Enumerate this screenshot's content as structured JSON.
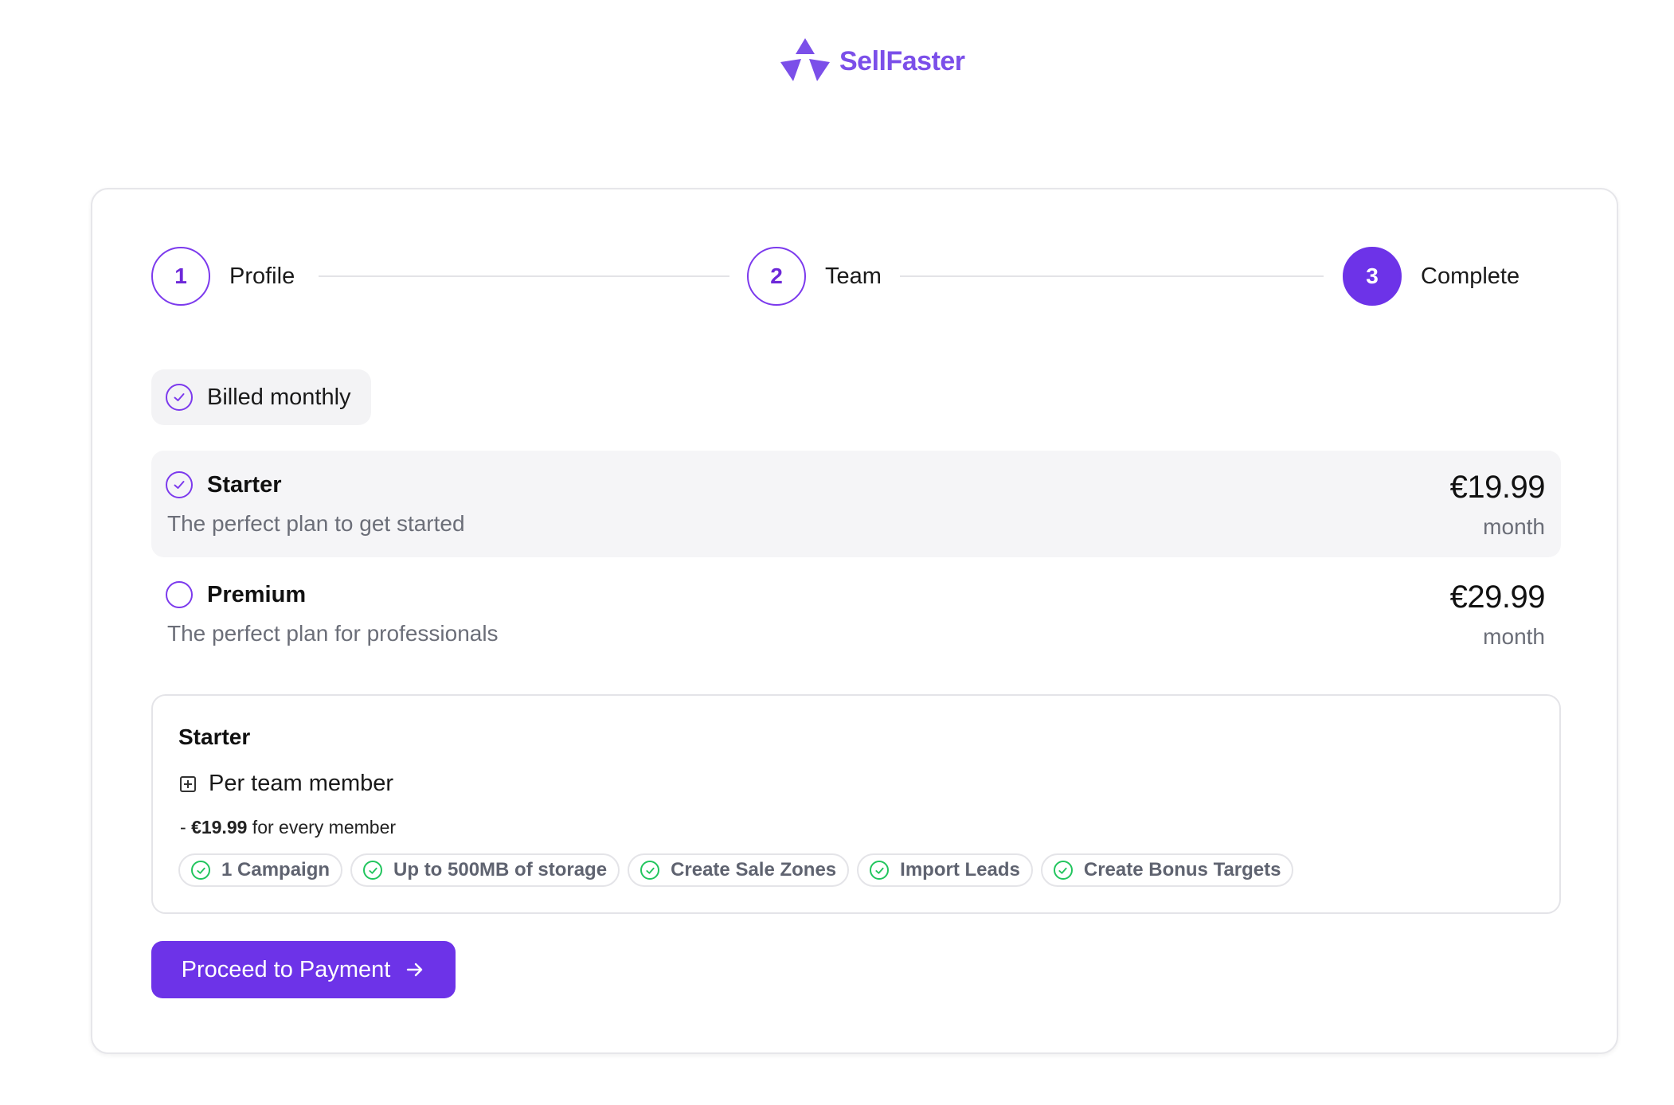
{
  "brand": {
    "name": "SellFaster",
    "color": "#7b4fe9",
    "logo_icon": "three-triangle-logo-icon"
  },
  "stepper": {
    "steps": [
      {
        "number": "1",
        "label": "Profile",
        "state": "done"
      },
      {
        "number": "2",
        "label": "Team",
        "state": "done"
      },
      {
        "number": "3",
        "label": "Complete",
        "state": "active"
      }
    ]
  },
  "billing": {
    "label": "Billed monthly",
    "checked": true
  },
  "plans": [
    {
      "name": "Starter",
      "description": "The perfect plan to get started",
      "price": "€19.99",
      "period": "month",
      "selected": true
    },
    {
      "name": "Premium",
      "description": "The perfect plan for professionals",
      "price": "€29.99",
      "period": "month",
      "selected": false
    }
  ],
  "summary": {
    "title": "Starter",
    "member_label": "Per team member",
    "price_prefix": "- ",
    "price_value": "€19.99",
    "price_suffix": " for every member",
    "features": [
      "1 Campaign",
      "Up to 500MB of storage",
      "Create Sale Zones",
      "Import Leads",
      "Create Bonus Targets"
    ]
  },
  "cta": {
    "label": "Proceed to Payment",
    "icon": "arrow-right-icon"
  },
  "colors": {
    "accent": "#6d33e8",
    "success": "#22c55e",
    "muted_text": "#6b6e78",
    "selected_bg": "#f5f5f7"
  }
}
